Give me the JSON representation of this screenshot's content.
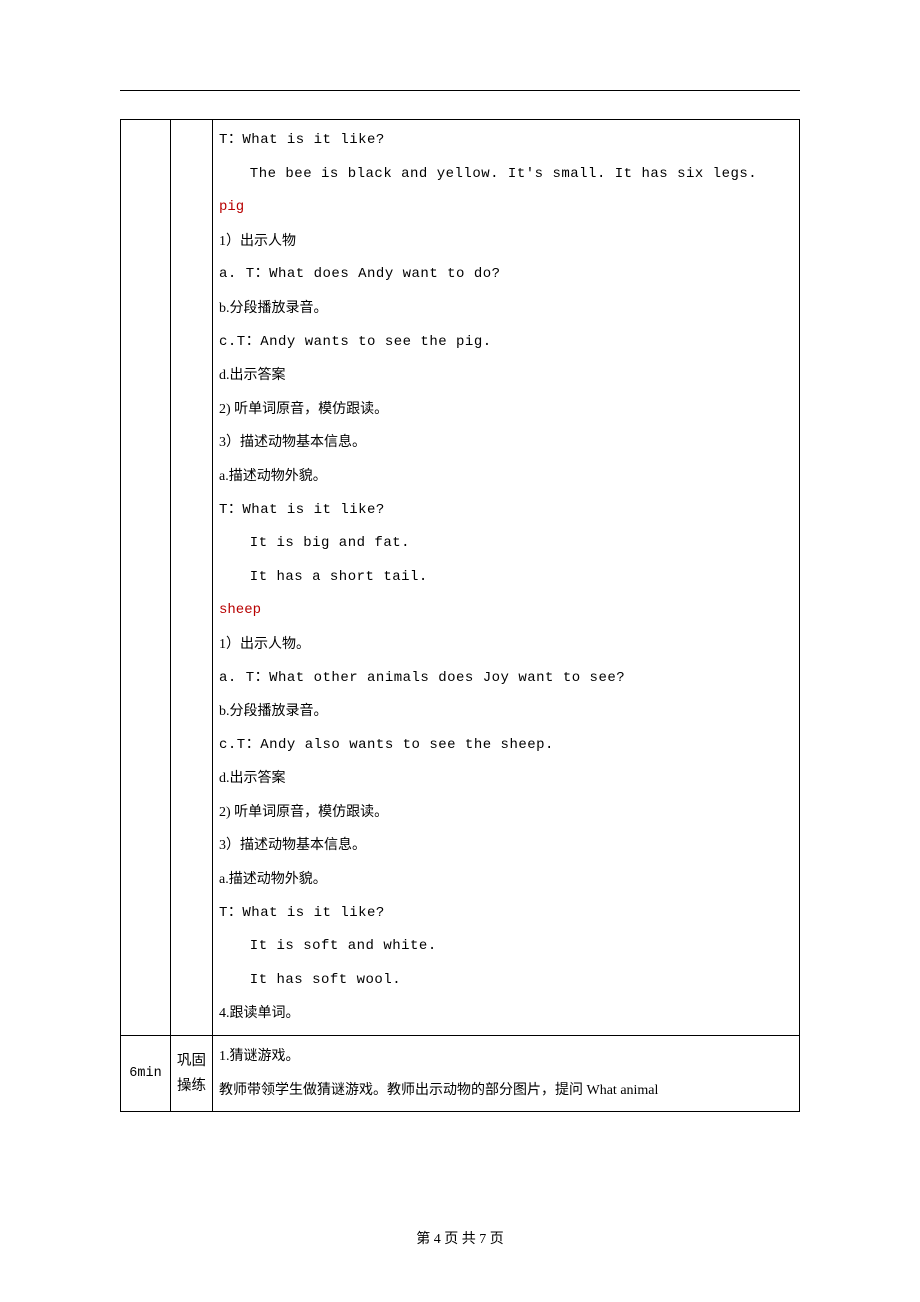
{
  "page": {
    "footer": "第 4 页 共 7 页"
  },
  "row_main": {
    "time": "",
    "stage": "",
    "lines": [
      {
        "text": "T：What is it like?",
        "cls": "mono"
      },
      {
        "text": "The bee is black and yellow. It's small. It has six legs.",
        "cls": "mono indent"
      },
      {
        "text": "pig",
        "cls": "keyword"
      },
      {
        "text": "1）出示人物",
        "cls": ""
      },
      {
        "text": "a. T：What does Andy want to do?",
        "cls": "mono"
      },
      {
        "text": "b.分段播放录音。",
        "cls": ""
      },
      {
        "text": "c.T：Andy wants to see the pig.",
        "cls": "mono"
      },
      {
        "text": "d.出示答案",
        "cls": ""
      },
      {
        "text": "2) 听单词原音，模仿跟读。",
        "cls": ""
      },
      {
        "text": "3）描述动物基本信息。",
        "cls": ""
      },
      {
        "text": "a.描述动物外貌。",
        "cls": ""
      },
      {
        "text": "T：What is it like?",
        "cls": "mono"
      },
      {
        "text": "It is big and fat.",
        "cls": "mono indent"
      },
      {
        "text": "It has a short tail.",
        "cls": "mono indent"
      },
      {
        "text": "sheep",
        "cls": "keyword"
      },
      {
        "text": "1）出示人物。",
        "cls": ""
      },
      {
        "text": "a. T：What other animals does Joy want to see?",
        "cls": "mono"
      },
      {
        "text": "b.分段播放录音。",
        "cls": ""
      },
      {
        "text": "c.T：Andy also wants to see the sheep.",
        "cls": "mono"
      },
      {
        "text": "d.出示答案",
        "cls": ""
      },
      {
        "text": "2) 听单词原音，模仿跟读。",
        "cls": ""
      },
      {
        "text": "3）描述动物基本信息。",
        "cls": ""
      },
      {
        "text": "a.描述动物外貌。",
        "cls": ""
      },
      {
        "text": "T：What is it like?",
        "cls": "mono"
      },
      {
        "text": "It is soft and white.",
        "cls": "mono indent"
      },
      {
        "text": "It has soft wool.",
        "cls": "mono indent"
      },
      {
        "text": "4.跟读单词。",
        "cls": ""
      }
    ]
  },
  "row_practice": {
    "time": "6min",
    "stage": "巩固操练",
    "lines": [
      {
        "text": "1.猜谜游戏。",
        "cls": ""
      },
      {
        "text": "教师带领学生做猜谜游戏。教师出示动物的部分图片，提问 What animal",
        "cls": ""
      }
    ]
  }
}
